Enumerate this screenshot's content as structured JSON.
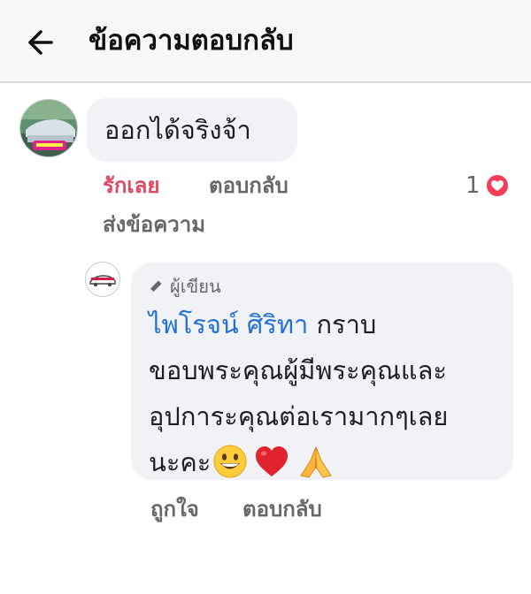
{
  "header": {
    "title": "ข้อความตอบกลับ",
    "back_icon": "arrow-left-icon"
  },
  "comment": {
    "text": "ออกได้จริงจ้า",
    "actions": {
      "love": "รักเลย",
      "reply": "ตอบกลับ",
      "send_message": "ส่งข้อความ"
    },
    "reaction_count": "1",
    "reaction_icon": "heart-icon",
    "colors": {
      "love": "#e2485f",
      "heart_badge": "#f33e58"
    }
  },
  "reply": {
    "author_badge": "ผู้เขียน",
    "author_badge_icon": "pencil-icon",
    "tagged_name": "ไพโรจน์ ศิริทา",
    "text_line1": " กราบ",
    "text_line2": "ขอบพระคุณผู้มีพระคุณและ",
    "text_line3": "อุปการะคุณต่อเรามากๆเลย",
    "text_line4": "นะคะ",
    "emojis": [
      "grinning-face-icon",
      "red-heart-icon",
      "folded-hands-icon"
    ],
    "actions": {
      "like": "ถูกใจ",
      "reply": "ตอบกลับ"
    },
    "colors": {
      "tag": "#216fdb"
    }
  }
}
